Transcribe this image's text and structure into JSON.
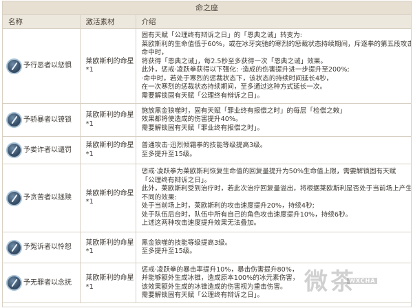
{
  "table_title": "命之座",
  "headers": {
    "name": "名称",
    "material": "激活素材",
    "intro": "介绍"
  },
  "rows": [
    {
      "name": "予行恶者以惩惧",
      "material": "莱欧斯利的命星*1",
      "lines": [
        "固有天赋「公理终有辩诉之日」的「恩典之诫」转变为:",
        "莱欧斯利的生命值低于60%，或在冰牙突驰的寒烈的惩裁状态持续期间，斥逐拳的第五段攻击",
        "命中时，",
        "将获得「恩典之诫」，每2.5秒至多获得一次「恩典之诫」效果。",
        "此外，惩戒·凌跃拳获得以下强化: ·造成的伤害提升进一步提升至200%;",
        "·命中时，若处于寒烈的惩裁状态下，该状态的持续时间延长4秒，",
        "在一次寒烈的惩裁状态持续期间，至多通过这种方式延长一次。",
        "需要解锁固有天赋「公理终有辩诉之日」。"
      ]
    },
    {
      "name": "予骄暴者以镣锁",
      "material": "莱欧斯利的命星*1",
      "lines": [
        "施放黑金狼噬时，固有天赋「罪业终有报偿之时」的每层「检偿之敕」",
        "效果都将使造成的伤害提升40%。",
        "需要解锁固有天赋「罪业终有报偿之时」。"
      ]
    },
    {
      "name": "予娄诈者以谴罚",
      "material": "莱欧斯利的命星*1",
      "lines": [
        "普通攻击·迅烈倾霜拳的技能等级提高3级。",
        "至多提升至15级。"
      ]
    },
    {
      "name": "予贪苦者以拯赎",
      "material": "莱欧斯利的命星*1",
      "lines": [
        "惩戒·凌跃拳为莱欧斯利恢复生命值的回复量提升为50%生命值上限，需要解锁固有天赋",
        "「公理终有辩诉之日」。",
        "此外，莱欧斯利受到治疗时，若此次治疗回复量溢出，将根据莱欧斯利是否处于当前场上产生",
        "不同的效果:",
        "处于当前场上时，莱欧斯利的攻击速度提升20%，持续4秒;",
        "处于队伍后台时，队伍中所有自己的角色攻击速度提升10%，持续6秒。",
        "上述这两种攻击速度提升效果无法叠加。"
      ]
    },
    {
      "name": "予冤诉者以怜恕",
      "material": "莱欧斯利的命星*1",
      "lines": [
        "黑金狼噬的技能等级提高3级。",
        "至多提升至15级。"
      ]
    },
    {
      "name": "予无罪者以念抚",
      "material": "莱欧斯利的命星*1",
      "lines": [
        "惩戒·凌跃拳的暴击率提升10%，暴击伤害提升80%，",
        "并能够额外生成冰锥，造成原本100%的冰元素伤害，",
        "该效果额外生成的冰锥造成的伤害视为重击伤害。",
        "需要解锁固有天赋「公理终有辩诉之日」。"
      ]
    }
  ],
  "watermark": {
    "text": "微茶",
    "small": "WXCHA"
  }
}
